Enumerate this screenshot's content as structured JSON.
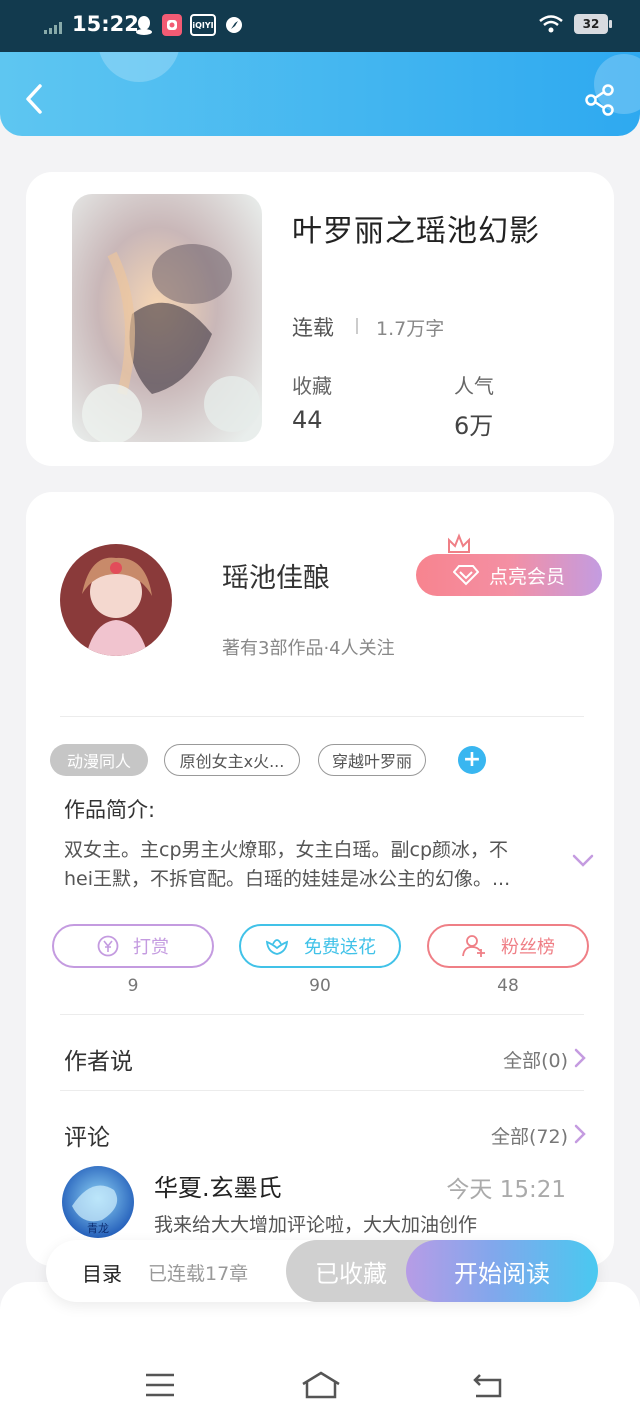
{
  "status_bar": {
    "time": "15:22",
    "battery": "32",
    "app_icons": [
      "qq-icon",
      "app-icon",
      "iqiyi-icon",
      "compass-icon"
    ],
    "iqiyi_text": "iQIYI"
  },
  "header": {
    "back": "back-icon",
    "share": "share-icon",
    "accent": "#2ea9f0"
  },
  "book": {
    "title": "叶罗丽之瑶池幻影",
    "status": "连载",
    "words": "1.7万字",
    "stats": [
      {
        "label": "收藏",
        "value": "44"
      },
      {
        "label": "人气",
        "value": "6万"
      }
    ]
  },
  "author": {
    "name": "瑶池佳酿",
    "meta": "著有3部作品·4人关注",
    "vip_label": "点亮会员"
  },
  "tags": [
    "动漫同人",
    "原创女主x火...",
    "穿越叶罗丽"
  ],
  "intro": {
    "title": "作品简介:",
    "line1": "双女主。主cp男主火燎耶，女主白瑶。副cp颜冰，不",
    "line2": "hei王默，不拆官配。白瑶的娃娃是冰公主的幻像。..."
  },
  "actions": [
    {
      "label": "打赏",
      "count": "9",
      "color": "#c49be0"
    },
    {
      "label": "免费送花",
      "count": "90",
      "color": "#41c2e8"
    },
    {
      "label": "粉丝榜",
      "count": "48",
      "color": "#ef7f86"
    }
  ],
  "author_says": {
    "title": "作者说",
    "more": "全部(0)"
  },
  "comments": {
    "title": "评论",
    "more": "全部(72)",
    "items": [
      {
        "user": "华夏.玄墨氏",
        "time": "今天 15:21",
        "text": "我来给大大增加评论啦，大大加油创作",
        "avatar_label": "青龙"
      }
    ]
  },
  "read_bar": {
    "toc": "目录",
    "chapters": "已连载17章",
    "collected": "已收藏",
    "read": "开始阅读"
  },
  "nav": [
    "menu-icon",
    "home-icon",
    "back-nav-icon"
  ]
}
